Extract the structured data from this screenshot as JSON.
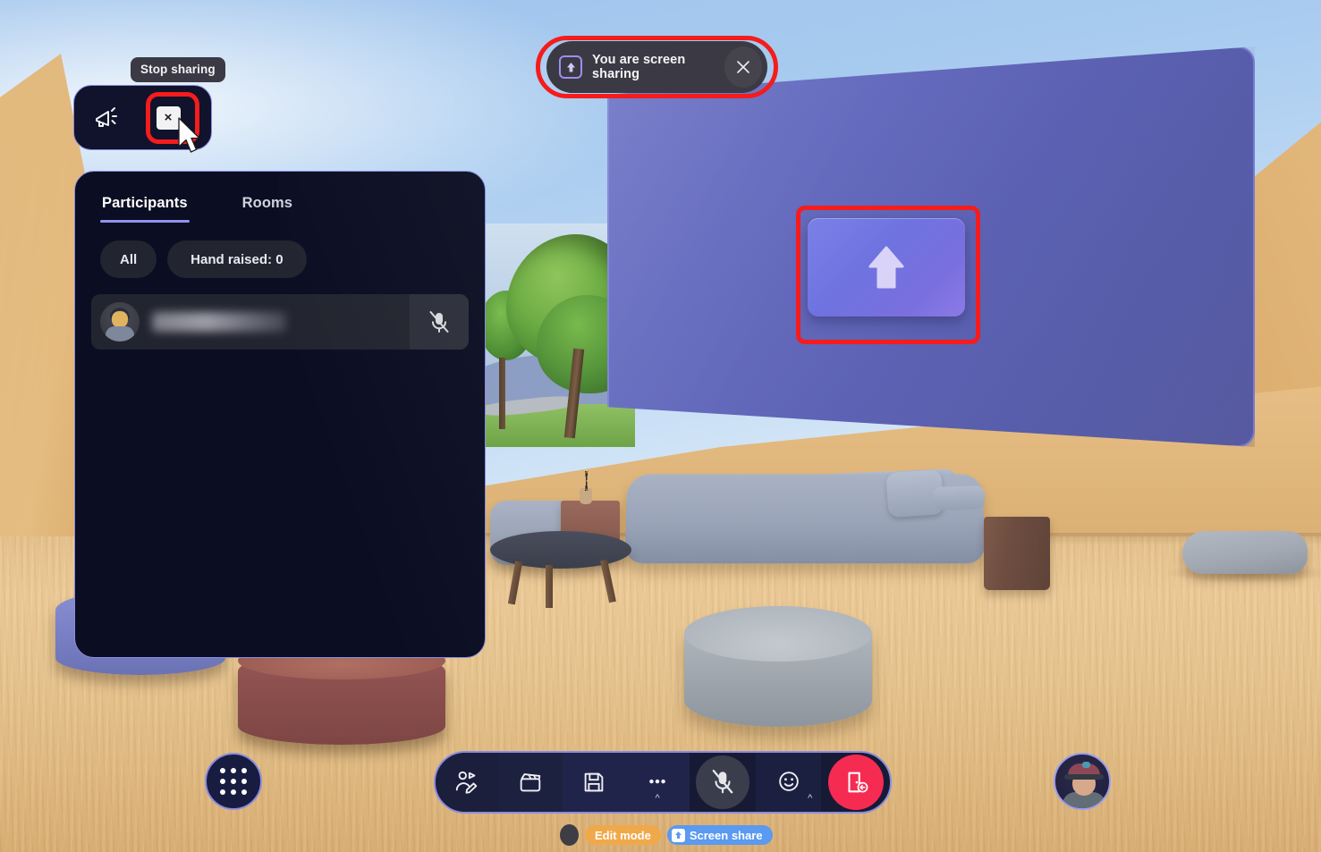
{
  "scene": {
    "name": "virtual-meeting-room-canyon",
    "sky_color": "#a8cbef",
    "ground_color": "#e7c48d",
    "rock_color": "#d9ab6e"
  },
  "tooltip": {
    "label": "Stop sharing"
  },
  "control_pill": {
    "bullhorn_icon": "bullhorn-icon",
    "close_icon": "close-icon",
    "close_label": "×"
  },
  "share_banner": {
    "icon": "screen-share-up-icon",
    "message": "You are screen sharing",
    "close_label": "×",
    "background": "#3b3a44"
  },
  "panel": {
    "tabs": [
      {
        "label": "Participants",
        "active": true
      },
      {
        "label": "Rooms",
        "active": false
      }
    ],
    "filters": [
      {
        "label": "All"
      },
      {
        "label": "Hand raised: 0"
      }
    ],
    "participants": [
      {
        "name": "",
        "name_redacted": true,
        "muted": true,
        "mic_icon": "mic-off-icon"
      }
    ],
    "accent": "#8f93f0",
    "background": "#0b0d22"
  },
  "display_board": {
    "placeholder_icon": "arrow-up-icon",
    "board_color": "#6167bd",
    "placeholder_color": "#7b80e8"
  },
  "grid_button": {
    "icon": "apps-grid-icon"
  },
  "toolbar": {
    "background": "#171a34",
    "border": "#8a8ce0",
    "buttons": [
      {
        "name": "avatar-edit-button",
        "icon": "avatar-pencil-icon",
        "has_caret": false
      },
      {
        "name": "media-clapperboard-button",
        "icon": "clapperboard-icon",
        "has_caret": false
      },
      {
        "name": "save-button",
        "icon": "floppy-disk-icon",
        "has_caret": false
      },
      {
        "name": "more-options-button",
        "icon": "ellipsis-icon",
        "has_caret": true
      },
      {
        "name": "microphone-toggle-button",
        "icon": "mic-off-icon",
        "has_caret": false
      },
      {
        "name": "reactions-button",
        "icon": "smiley-icon",
        "has_caret": true
      },
      {
        "name": "leave-room-button",
        "icon": "leave-door-icon",
        "has_caret": false,
        "color": "#f62b52"
      }
    ]
  },
  "status": {
    "edit_mode_label": "Edit mode",
    "edit_mode_color": "#f0a94a",
    "screen_share_label": "Screen share",
    "screen_share_color": "#5a9af0",
    "screen_share_icon": "screen-share-up-icon"
  },
  "self_avatar": {
    "name": "self-avatar"
  },
  "annotations": [
    {
      "name": "highlight-share-banner",
      "color": "#f41c1c"
    },
    {
      "name": "highlight-stop-sharing-close",
      "color": "#f41c1c"
    },
    {
      "name": "highlight-shared-screen",
      "color": "#f41c1c"
    }
  ]
}
